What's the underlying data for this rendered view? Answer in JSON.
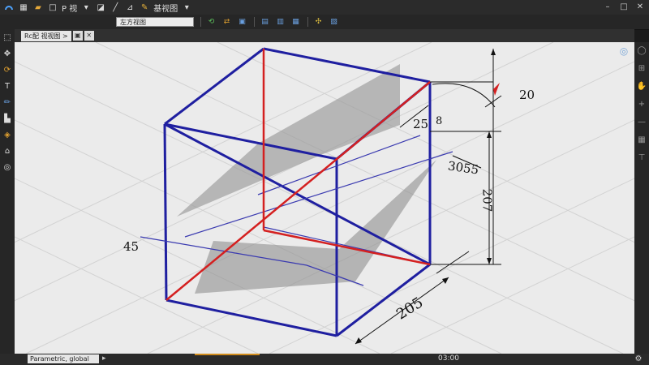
{
  "topbar": {
    "view_menu_1": "P 视",
    "view_menu_2": "基视图"
  },
  "ribbon": {
    "view_select": "左方视图"
  },
  "doc_tab": {
    "label": "Rc配 视视图 >"
  },
  "dimensions": {
    "left": "45",
    "top_right_angle": "20",
    "mid": "25",
    "mid_suffix": "8",
    "right_upper": "3055",
    "right_vertical": "207",
    "bottom": "205"
  },
  "status": {
    "field": "Parametric, global",
    "coords": "03:00"
  },
  "colors": {
    "cube_edges": "#1f1fa0",
    "diagonal": "#d42020",
    "grid": "#d0d0d0",
    "plane": "#8a8a8a"
  }
}
